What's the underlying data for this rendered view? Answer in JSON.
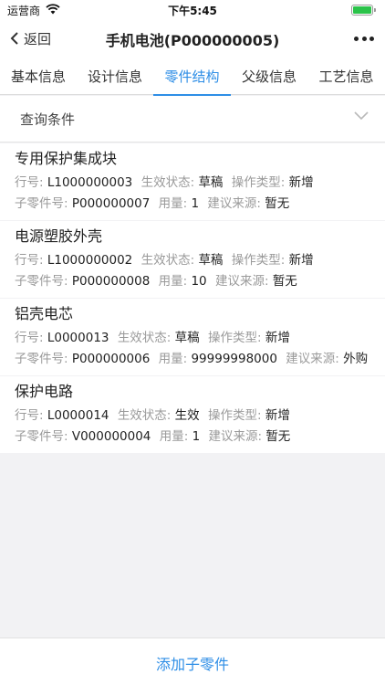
{
  "status_bar": {
    "carrier": "运营商",
    "time": "下午5:45",
    "battery_level": 1.0,
    "battery_color": "#2bc34a"
  },
  "nav": {
    "back_label": "返回",
    "title": "手机电池(P000000005)"
  },
  "tabs": [
    {
      "label": "基本信息",
      "active": false
    },
    {
      "label": "设计信息",
      "active": false
    },
    {
      "label": "零件结构",
      "active": true
    },
    {
      "label": "父级信息",
      "active": false
    },
    {
      "label": "工艺信息",
      "active": false
    }
  ],
  "query": {
    "label": "查询条件"
  },
  "labels": {
    "line_no": "行号:",
    "status": "生效状态:",
    "op_type": "操作类型:",
    "child_no": "子零件号:",
    "quantity": "用量:",
    "source": "建议来源:"
  },
  "parts": [
    {
      "name": "专用保护集成块",
      "line_no": "L1000000003",
      "status": "草稿",
      "op_type": "新增",
      "child_no": "P000000007",
      "quantity": "1",
      "source": "暂无"
    },
    {
      "name": "电源塑胶外壳",
      "line_no": "L1000000002",
      "status": "草稿",
      "op_type": "新增",
      "child_no": "P000000008",
      "quantity": "10",
      "source": "暂无"
    },
    {
      "name": "铝壳电芯",
      "line_no": "L0000013",
      "status": "草稿",
      "op_type": "新增",
      "child_no": "P000000006",
      "quantity": "99999998000",
      "source": "外购"
    },
    {
      "name": "保护电路",
      "line_no": "L0000014",
      "status": "生效",
      "op_type": "新增",
      "child_no": "V000000004",
      "quantity": "1",
      "source": "暂无"
    }
  ],
  "bottom": {
    "add_label": "添加子零件"
  },
  "colors": {
    "accent": "#2e8ee6",
    "label_gray": "#9a9a9a",
    "background": "#f2f2f4"
  }
}
